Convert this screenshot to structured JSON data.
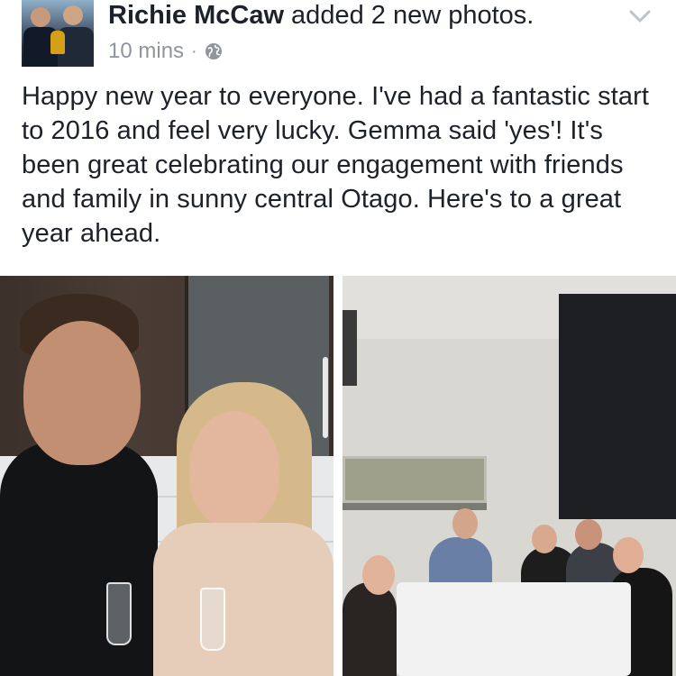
{
  "post": {
    "author_name": "Richie McCaw",
    "action": " added 2 new photos.",
    "timestamp": "10 mins",
    "separator": "·",
    "privacy_icon": "globe-icon",
    "menu_icon": "chevron-down-icon",
    "text": "Happy new year to everyone. I've had a fantastic start to 2016 and feel very lucky. Gemma said 'yes'! It's been great celebrating our engagement with friends and family in sunny central Otago. Here's to a great year ahead."
  },
  "photos": [
    {
      "name": "couple-photo"
    },
    {
      "name": "dinner-table-photo"
    }
  ],
  "colors": {
    "text": "#1d2129",
    "meta": "#90949c"
  }
}
